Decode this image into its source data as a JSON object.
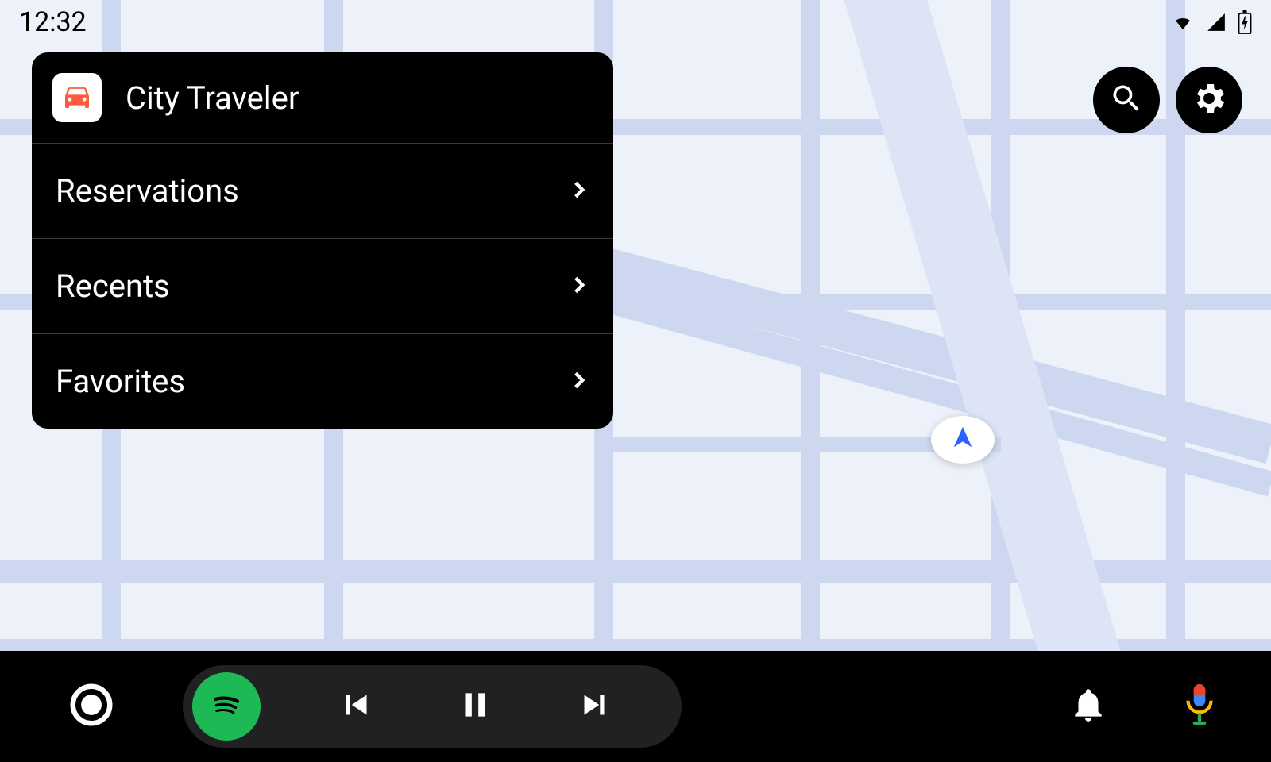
{
  "statusbar": {
    "time": "12:32",
    "wifi_icon": "wifi",
    "signal_icon": "cell-signal",
    "battery_icon": "battery-charging"
  },
  "top_actions": {
    "search_icon": "search",
    "settings_icon": "settings"
  },
  "panel": {
    "app_icon": "car",
    "app_name": "City Traveler",
    "items": [
      {
        "label": "Reservations"
      },
      {
        "label": "Recents"
      },
      {
        "label": "Favorites"
      }
    ]
  },
  "location_marker": {
    "icon": "navigation-arrow"
  },
  "bottombar": {
    "launcher_icon": "circle",
    "media_app_icon": "spotify",
    "prev_icon": "skip-previous",
    "pause_icon": "pause",
    "next_icon": "skip-next",
    "notifications_icon": "bell",
    "mic_icon": "google-mic"
  }
}
